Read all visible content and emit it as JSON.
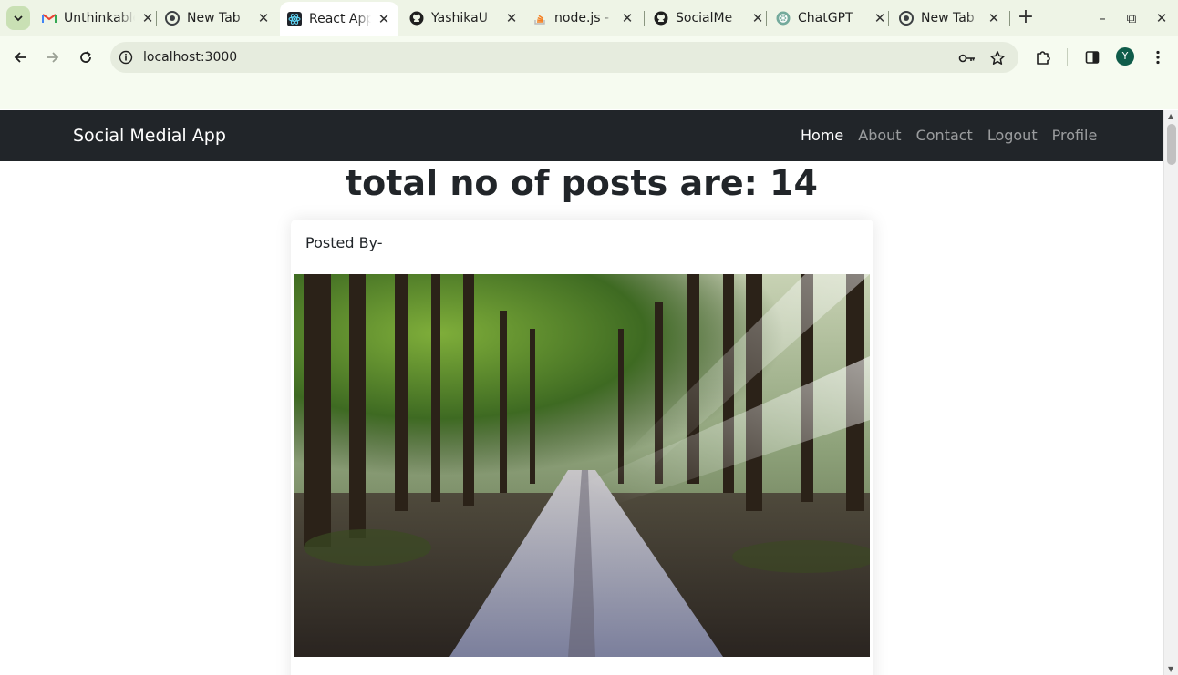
{
  "browser": {
    "tabs": [
      {
        "title": "Unthinkable",
        "icon": "gmail-icon",
        "close": "✕"
      },
      {
        "title": "New Tab",
        "icon": "chrome-icon",
        "close": "✕"
      },
      {
        "title": "React App",
        "icon": "react-icon",
        "close": "✕"
      },
      {
        "title": "YashikaU",
        "icon": "github-icon",
        "close": "✕"
      },
      {
        "title": "node.js - ",
        "icon": "stackoverflow-icon",
        "close": "✕"
      },
      {
        "title": "SocialMe",
        "icon": "github-icon",
        "close": "✕"
      },
      {
        "title": "ChatGPT",
        "icon": "chatgpt-icon",
        "close": "✕"
      },
      {
        "title": "New Tab",
        "icon": "chrome-icon",
        "close": "✕"
      }
    ],
    "active_tab_index": 2,
    "new_tab_glyph": "+",
    "window_controls": {
      "minimize": "–",
      "maximize": "⧉",
      "close": "✕"
    },
    "address": "localhost:3000",
    "profile_initial": "Y",
    "accent_color": "#c9e0b4"
  },
  "navbar": {
    "brand": "Social Medial App",
    "links": [
      {
        "label": "Home",
        "active": true
      },
      {
        "label": "About",
        "active": false
      },
      {
        "label": "Contact",
        "active": false
      },
      {
        "label": "Logout",
        "active": false
      },
      {
        "label": "Profile",
        "active": false
      }
    ],
    "background_color": "#212529"
  },
  "main": {
    "heading": "total no of posts are: 14",
    "post": {
      "header": "Posted By-",
      "image_subject": "forest-road-photo"
    }
  }
}
